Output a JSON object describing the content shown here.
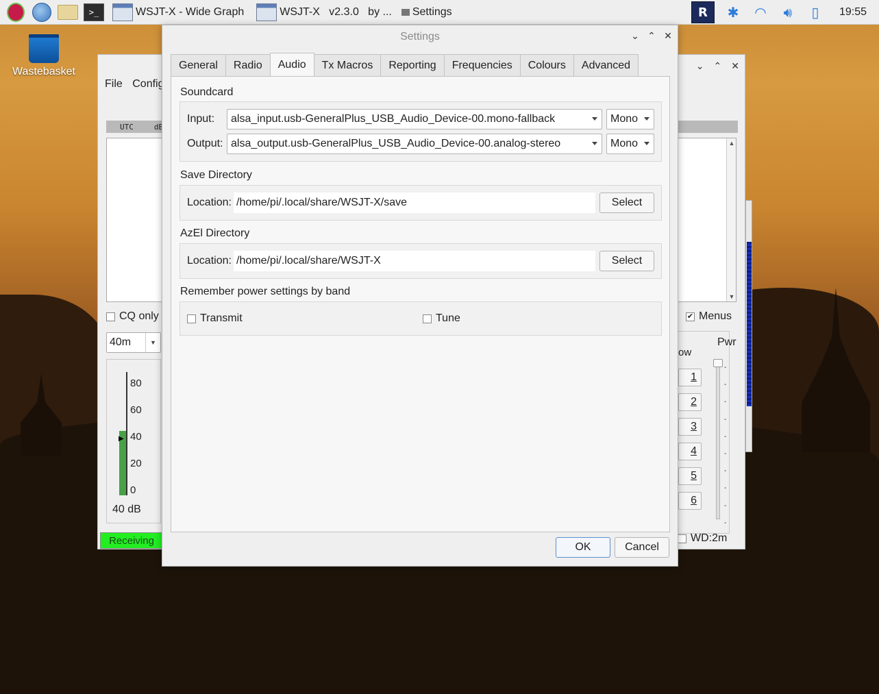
{
  "taskbar": {
    "tasks": [
      {
        "label": "WSJT-X - Wide Graph"
      },
      {
        "label": "WSJT-X   v2.3.0   by ..."
      }
    ],
    "settings_task": "Settings",
    "clock": "19:55",
    "vnc_label": "R"
  },
  "desktop": {
    "wastebasket_label": "Wastebasket"
  },
  "main_window": {
    "menu_file": "File",
    "menu_config": "Config",
    "utc_header": "UTC",
    "db_header": "dB",
    "cq_only": "CQ only",
    "band": "40m",
    "meter_ticks": [
      "80",
      "60",
      "40",
      "20",
      "0"
    ],
    "meter_db": "40 dB",
    "status": "Receiving",
    "menus_label": "Menus",
    "menus_checked": true,
    "tx_group_label": "ow",
    "tx_buttons": [
      "1",
      "2",
      "3",
      "4",
      "5",
      "6"
    ],
    "pwr_label": "Pwr",
    "wd_label": "WD:2m",
    "meter_level_db": 40,
    "status_color": "#22ee22"
  },
  "settings": {
    "title": "Settings",
    "tabs": [
      "General",
      "Radio",
      "Audio",
      "Tx Macros",
      "Reporting",
      "Frequencies",
      "Colours",
      "Advanced"
    ],
    "active_tab": "Audio",
    "soundcard": {
      "title": "Soundcard",
      "input_label": "Input:",
      "input_value": "alsa_input.usb-GeneralPlus_USB_Audio_Device-00.mono-fallback",
      "input_channel": "Mono",
      "output_label": "Output:",
      "output_value": "alsa_output.usb-GeneralPlus_USB_Audio_Device-00.analog-stereo",
      "output_channel": "Mono"
    },
    "save_dir": {
      "title": "Save Directory",
      "location_label": "Location:",
      "path": "/home/pi/.local/share/WSJT-X/save",
      "select_label": "Select"
    },
    "azel_dir": {
      "title": "AzEl Directory",
      "location_label": "Location:",
      "path": "/home/pi/.local/share/WSJT-X",
      "select_label": "Select"
    },
    "power": {
      "title": "Remember power settings by band",
      "transmit_label": "Transmit",
      "tune_label": "Tune",
      "transmit_checked": false,
      "tune_checked": false
    },
    "ok_label": "OK",
    "cancel_label": "Cancel"
  }
}
